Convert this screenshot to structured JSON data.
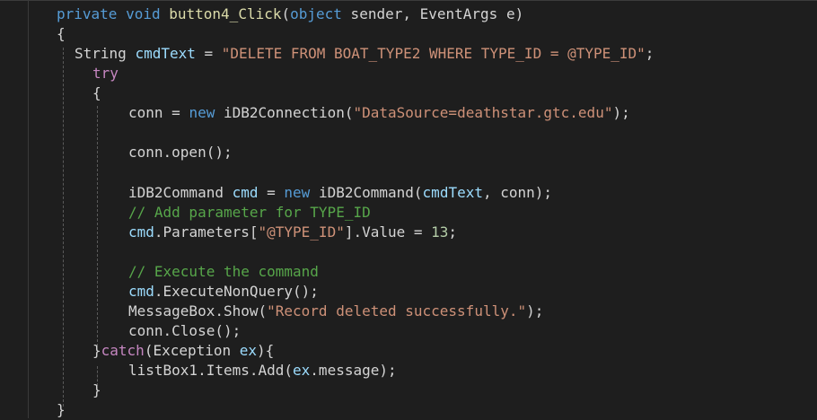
{
  "code": {
    "lines": [
      {
        "tokens": [
          {
            "t": "private",
            "c": "kw"
          },
          {
            "t": " ",
            "c": "plain"
          },
          {
            "t": "void",
            "c": "kw"
          },
          {
            "t": " ",
            "c": "plain"
          },
          {
            "t": "button4_Click",
            "c": "fn"
          },
          {
            "t": "(",
            "c": "plain"
          },
          {
            "t": "object",
            "c": "kw"
          },
          {
            "t": " sender, EventArgs e)",
            "c": "plain"
          }
        ]
      },
      {
        "tokens": [
          {
            "t": "{",
            "c": "plain"
          }
        ]
      },
      {
        "tokens": [
          {
            "t": "String ",
            "c": "plain"
          },
          {
            "t": "cmdText",
            "c": "var"
          },
          {
            "t": " = ",
            "c": "plain"
          },
          {
            "t": "\"DELETE FROM BOAT_TYPE2 WHERE TYPE_ID = @TYPE_ID\"",
            "c": "str"
          },
          {
            "t": ";",
            "c": "plain"
          }
        ]
      },
      {
        "tokens": [
          {
            "t": "try",
            "c": "ctl"
          }
        ]
      },
      {
        "tokens": [
          {
            "t": "{",
            "c": "plain"
          }
        ]
      },
      {
        "tokens": [
          {
            "t": "conn = ",
            "c": "plain"
          },
          {
            "t": "new",
            "c": "kw"
          },
          {
            "t": " iDB2Connection(",
            "c": "plain"
          },
          {
            "t": "\"DataSource=deathstar.gtc.edu\"",
            "c": "str"
          },
          {
            "t": ");",
            "c": "plain"
          }
        ]
      },
      {
        "tokens": []
      },
      {
        "tokens": [
          {
            "t": "conn.open();",
            "c": "plain"
          }
        ]
      },
      {
        "tokens": []
      },
      {
        "tokens": [
          {
            "t": "iDB2Command ",
            "c": "plain"
          },
          {
            "t": "cmd",
            "c": "var"
          },
          {
            "t": " = ",
            "c": "plain"
          },
          {
            "t": "new",
            "c": "kw"
          },
          {
            "t": " iDB2Command(",
            "c": "plain"
          },
          {
            "t": "cmdText",
            "c": "var"
          },
          {
            "t": ", conn);",
            "c": "plain"
          }
        ]
      },
      {
        "tokens": [
          {
            "t": "// Add parameter for TYPE_ID",
            "c": "cmt"
          }
        ]
      },
      {
        "tokens": [
          {
            "t": "cmd",
            "c": "var"
          },
          {
            "t": ".Parameters[",
            "c": "plain"
          },
          {
            "t": "\"@TYPE_ID\"",
            "c": "str"
          },
          {
            "t": "].Value = ",
            "c": "plain"
          },
          {
            "t": "13",
            "c": "num"
          },
          {
            "t": ";",
            "c": "plain"
          }
        ]
      },
      {
        "tokens": []
      },
      {
        "tokens": [
          {
            "t": "// Execute the command",
            "c": "cmt"
          }
        ]
      },
      {
        "tokens": [
          {
            "t": "cmd",
            "c": "var"
          },
          {
            "t": ".ExecuteNonQuery();",
            "c": "plain"
          }
        ]
      },
      {
        "tokens": [
          {
            "t": "MessageBox.Show(",
            "c": "plain"
          },
          {
            "t": "\"Record deleted successfully.\"",
            "c": "str"
          },
          {
            "t": ");",
            "c": "plain"
          }
        ]
      },
      {
        "tokens": [
          {
            "t": "conn.Close();",
            "c": "plain"
          }
        ]
      },
      {
        "tokens": [
          {
            "t": "}",
            "c": "plain"
          },
          {
            "t": "catch",
            "c": "ctl"
          },
          {
            "t": "(Exception ",
            "c": "plain"
          },
          {
            "t": "ex",
            "c": "var"
          },
          {
            "t": "){",
            "c": "plain"
          }
        ]
      },
      {
        "tokens": [
          {
            "t": "listBox1.Items.Add(",
            "c": "plain"
          },
          {
            "t": "ex",
            "c": "var"
          },
          {
            "t": ".message);",
            "c": "plain"
          }
        ]
      },
      {
        "tokens": [
          {
            "t": "}",
            "c": "plain"
          }
        ]
      },
      {
        "tokens": [
          {
            "t": "}",
            "c": "plain"
          }
        ]
      }
    ]
  }
}
